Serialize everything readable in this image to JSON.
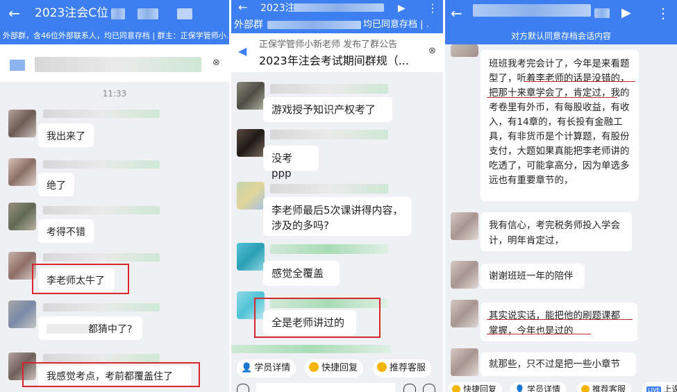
{
  "panel1": {
    "title": "2023注会C位",
    "subbar": "外部群，含46位外部联系人，均已同意存档 | 群主：正保学管师小...",
    "timestamp": "11:33",
    "messages": [
      {
        "text": "我出来了"
      },
      {
        "text": "绝了"
      },
      {
        "text": "考得不错"
      },
      {
        "text": "李老师太牛了"
      },
      {
        "text": "都猜中了?"
      },
      {
        "text": "我感觉考点，考前都覆盖住了"
      }
    ]
  },
  "panel2": {
    "title": "2023注",
    "subbar_left": "外部群",
    "subbar_right": "均已同意存档 | .",
    "notice_from": "正保学管师小新老师 发布了群公告",
    "notice_title": "2023年注会考试期间群规（...",
    "messages": [
      {
        "text": "游戏授予知识产权考了"
      },
      {
        "text": "没考ppp"
      },
      {
        "text": "李老师最后5次课讲得内容，涉及的多吗?"
      },
      {
        "text": "感觉全覆盖"
      },
      {
        "text": "全是老师讲过的"
      }
    ],
    "chips": [
      "学员详情",
      "快捷回复",
      "推荐客服"
    ]
  },
  "panel3": {
    "subbar": "对方默认同意存档会话内容",
    "messages": [
      {
        "text": "班班我考完会计了，今年是来看题型了，听着李老师的话是没错的，把那十来章学会了，肯定过，我的考卷里有外币，有每股收益，有收入，有14章的，有长投有金融工具，有非货币是个计算题，有股份支付，大题如果真能把李老师讲的吃透了，可能拿高分，因为单选多远也有重要章节的，"
      },
      {
        "text": "我有信心，考完税务师投入学会计，明年肯定过，"
      },
      {
        "text": "谢谢班班一年的陪伴"
      },
      {
        "text": "其实说实话，能把他的刷题课都掌握，今年也是过的"
      },
      {
        "text": "就那些，只不过是把一些小章节"
      }
    ],
    "chips": [
      "快捷回复",
      "学员详情",
      "推荐客服",
      "上课"
    ]
  },
  "icons": {
    "back": "back-arrow-icon",
    "more": "more-vertical-icon",
    "video": "video-call-icon",
    "close": "close-circle-icon",
    "announce": "megaphone-icon"
  },
  "colors": {
    "header": "#3d7ff0",
    "highlight": "#d9262c",
    "background": "#eef0f4"
  }
}
